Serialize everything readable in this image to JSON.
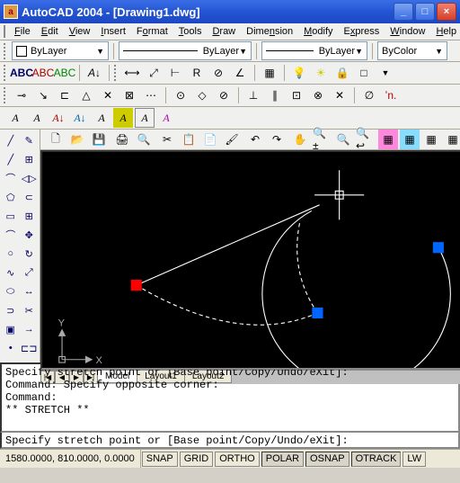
{
  "title": "AutoCAD 2004 - [Drawing1.dwg]",
  "menu": [
    "File",
    "Edit",
    "View",
    "Insert",
    "Format",
    "Tools",
    "Draw",
    "Dimension",
    "Modify",
    "Express",
    "Window",
    "Help"
  ],
  "layer_dropdown": "ByLayer",
  "linetype_dropdown": "ByLayer",
  "color_dropdown": "ByLayer",
  "lineweight_dropdown": "ByColor",
  "tabs": {
    "model": "Model",
    "lay1": "Layout1",
    "lay2": "Layout2"
  },
  "cmd_history": "Specify stretch point or [Base point/Copy/Undo/eXit]:\nCommand: Specify opposite corner:\nCommand:\n** STRETCH **",
  "cmd_prompt": "Specify stretch point or [Base point/Copy/Undo/eXit]:",
  "status": {
    "coords": "1580.0000, 810.0000, 0.0000",
    "snap": "SNAP",
    "grid": "GRID",
    "ortho": "ORTHO",
    "polar": "POLAR",
    "osnap": "OSNAP",
    "otrack": "OTRACK",
    "lwt": "LW"
  },
  "ucs": {
    "x": "X",
    "y": "Y"
  }
}
